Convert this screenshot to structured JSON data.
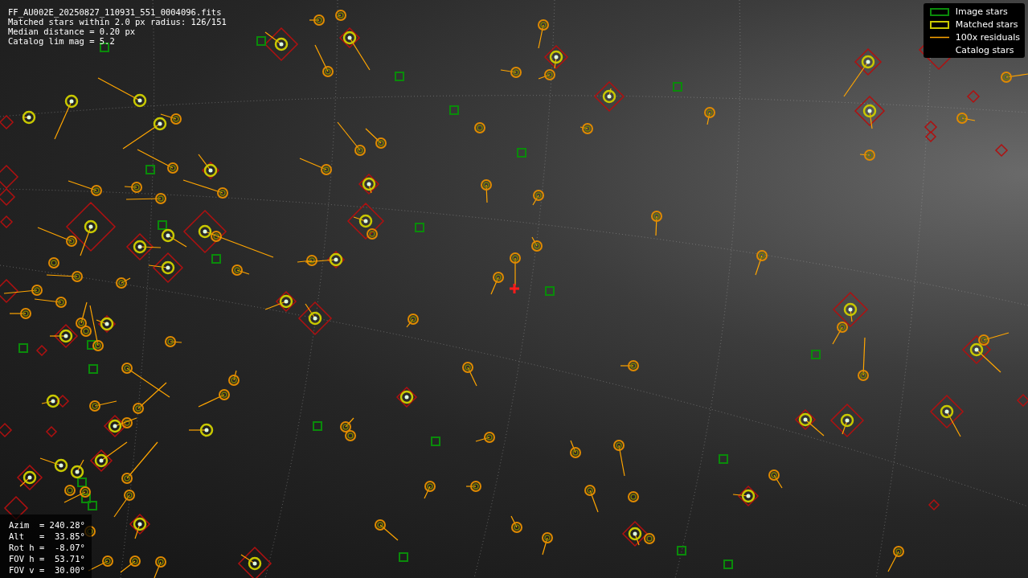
{
  "header_lines": [
    "FF_AU002E_20250827_110931_551_0004096.fits",
    "Matched stars within 2.0 px radius: 126/151",
    "Median distance = 0.20 px",
    "Catalog lim mag = 5.2"
  ],
  "legend": [
    {
      "kind": "image",
      "label": "Image stars"
    },
    {
      "kind": "matched",
      "label": "Matched stars"
    },
    {
      "kind": "residual",
      "label": "100x residuals"
    },
    {
      "kind": "catalog",
      "label": "Catalog stars"
    }
  ],
  "pointing_lines": [
    "Azim  = 240.28°",
    "Alt   =  33.85°",
    "Rot h =  -8.07°",
    "FOV h =  53.71°",
    "FOV v =  30.00°"
  ]
}
